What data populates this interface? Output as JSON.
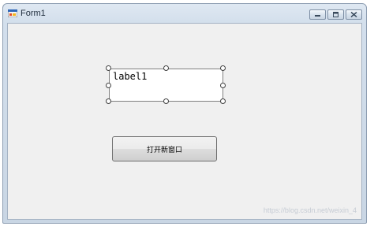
{
  "window": {
    "title": "Form1",
    "buttons": [
      "minimize",
      "maximize",
      "close"
    ]
  },
  "form": {
    "label_text": "label1",
    "button_label": "打开新窗口"
  },
  "watermark": "https://blog.csdn.net/weixin_4",
  "colors": {
    "client_background": "#f0f0f0",
    "titlebar": "#dfe8f2",
    "label_background": "#ffffff"
  }
}
